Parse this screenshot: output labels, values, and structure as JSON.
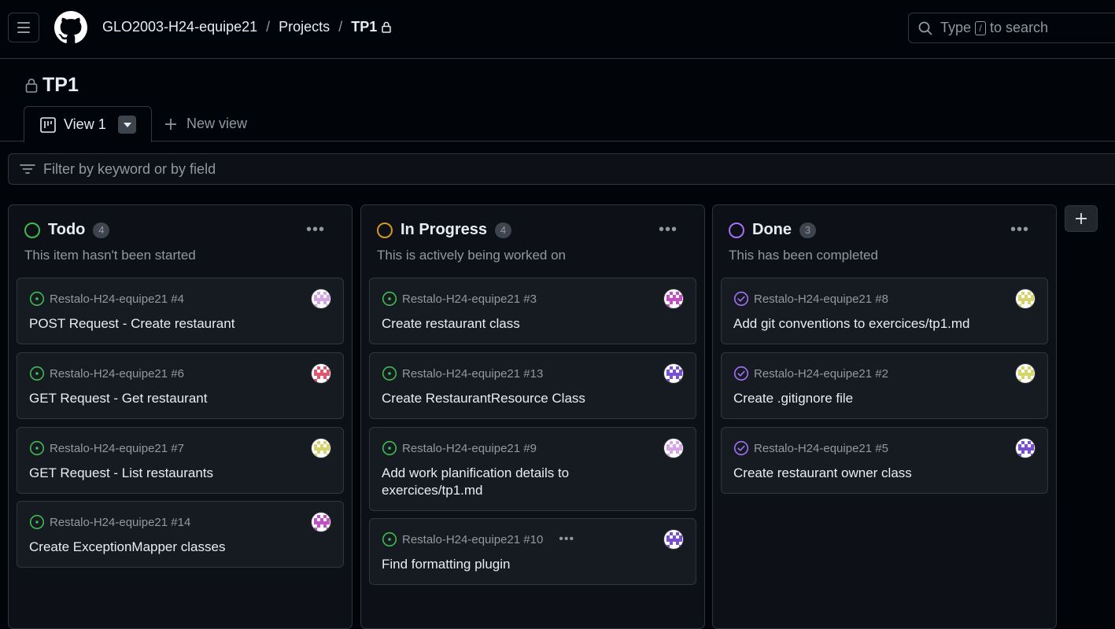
{
  "header": {
    "breadcrumbs": [
      "GLO2003-H24-equipe21",
      "Projects",
      "TP1"
    ],
    "separator": "/",
    "search": {
      "prefix": "Type",
      "key": "/",
      "suffix": "to search"
    }
  },
  "project": {
    "title": "TP1"
  },
  "tabs": {
    "active": "View 1",
    "new_view": "New view"
  },
  "filter": {
    "placeholder": "Filter by keyword or by field"
  },
  "colors": {
    "todo": "#3fb950",
    "in_progress": "#d29922",
    "done": "#a371f7",
    "open_issue": "#3fb950",
    "closed_issue": "#a371f7"
  },
  "columns": [
    {
      "title": "Todo",
      "count": "4",
      "description": "This item hasn't been started",
      "cards": [
        {
          "repo": "Restalo-H24-equipe21 #4",
          "title": "POST Request - Create restaurant",
          "avatar": "avatar-lilac"
        },
        {
          "repo": "Restalo-H24-equipe21 #6",
          "title": "GET Request - Get restaurant",
          "avatar": "avatar-red"
        },
        {
          "repo": "Restalo-H24-equipe21 #7",
          "title": "GET Request - List restaurants",
          "avatar": "avatar-yellow"
        },
        {
          "repo": "Restalo-H24-equipe21 #14",
          "title": "Create ExceptionMapper classes",
          "avatar": "avatar-magenta"
        }
      ]
    },
    {
      "title": "In Progress",
      "count": "4",
      "description": "This is actively being worked on",
      "cards": [
        {
          "repo": "Restalo-H24-equipe21 #3",
          "title": "Create restaurant class",
          "avatar": "avatar-magenta"
        },
        {
          "repo": "Restalo-H24-equipe21 #13",
          "title": "Create RestaurantResource Class",
          "avatar": "avatar-purple"
        },
        {
          "repo": "Restalo-H24-equipe21 #9",
          "title": "Add work planification details to exercices/tp1.md",
          "avatar": "avatar-lilac"
        },
        {
          "repo": "Restalo-H24-equipe21 #10",
          "title": "Find formatting plugin",
          "avatar": "avatar-purple",
          "more": "•••"
        }
      ]
    },
    {
      "title": "Done",
      "count": "3",
      "description": "This has been completed",
      "cards": [
        {
          "repo": "Restalo-H24-equipe21 #8",
          "title": "Add git conventions to exercices/tp1.md",
          "avatar": "avatar-yellow"
        },
        {
          "repo": "Restalo-H24-equipe21 #2",
          "title": "Create .gitignore file",
          "avatar": "avatar-yellow"
        },
        {
          "repo": "Restalo-H24-equipe21 #5",
          "title": "Create restaurant owner class",
          "avatar": "avatar-purple"
        }
      ]
    }
  ],
  "column_menu": "•••"
}
